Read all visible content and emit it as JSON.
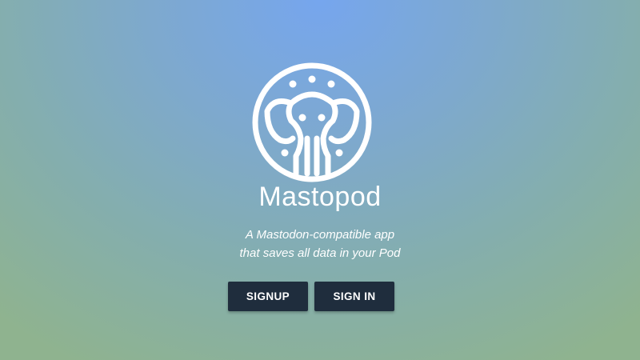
{
  "app": {
    "logo_icon": "elephant-logo-icon",
    "title": "Mastopod",
    "tagline_line1": "A Mastodon-compatible app",
    "tagline_line2": "that saves all data in your Pod"
  },
  "actions": {
    "signup_label": "SIGNUP",
    "signin_label": "SIGN IN"
  },
  "colors": {
    "button_bg": "#1f2d3d",
    "text": "#ffffff",
    "bg_top": "#76a6ee",
    "bg_bottom": "#8fb38f"
  }
}
